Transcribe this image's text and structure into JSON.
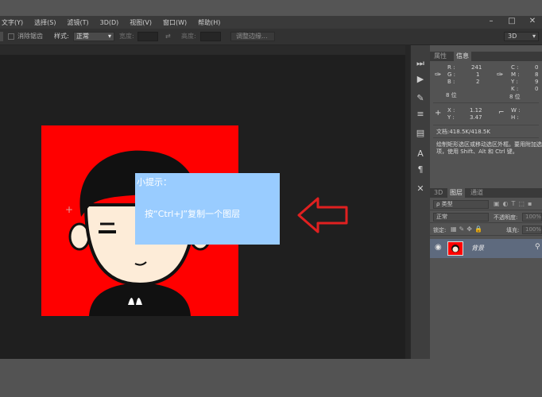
{
  "menu": [
    "文字(Y)",
    "选择(S)",
    "滤镜(T)",
    "3D(D)",
    "视图(V)",
    "窗口(W)",
    "帮助(H)"
  ],
  "options": {
    "antialias_label": "消除锯齿",
    "style_label": "样式:",
    "style_value": "正常",
    "width_label": "宽度:",
    "height_label": "高度:",
    "adjust_edge_label": "调整边缘...",
    "workspace": "3D"
  },
  "tip": {
    "title": "小提示：",
    "body": "按“Ctrl+J”复制一个图层"
  },
  "panel_top": {
    "tabs": [
      "属性",
      "信息"
    ],
    "rgb": {
      "r_label": "R :",
      "r": "241",
      "g_label": "G :",
      "g": "1",
      "b_label": "B :",
      "b": "2",
      "bits": "8 位"
    },
    "cmyk": {
      "c_label": "C :",
      "m_label": "M :",
      "y_label": "Y :",
      "k_label": "K :",
      "bits": "8 位",
      "c": "0",
      "m": "8",
      "y": "9",
      "k": "0"
    },
    "xy": {
      "x_label": "X :",
      "x": "1.12",
      "y_label": "Y :",
      "y": "3.47"
    },
    "wh": {
      "w_label": "W :",
      "h_label": "H :"
    },
    "doc": "文档:418.5K/418.5K",
    "hint": "绘制矩形选区或移动选区外框。要用附加选项，使用 Shift、Alt 和 Ctrl 键。"
  },
  "panel_layers": {
    "tabs": [
      "3D",
      "图层",
      "通道"
    ],
    "filter_label": "ρ 类型",
    "blend_mode": "正常",
    "opacity_label": "不透明度:",
    "opacity": "100%",
    "lock_label": "锁定:",
    "fill_label": "填充:",
    "fill": "100%",
    "layer_name": "背景"
  },
  "colors": {
    "canvas_bg": "#ff0000",
    "tip_bg": "#99ccff",
    "arrow": "#e02020"
  }
}
